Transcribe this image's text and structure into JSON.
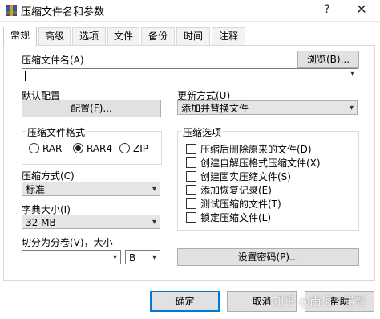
{
  "window": {
    "title": "压缩文件名和参数",
    "help_glyph": "?",
    "close_glyph": "✕"
  },
  "tabs": [
    {
      "label": "常规",
      "active": true
    },
    {
      "label": "高级"
    },
    {
      "label": "选项"
    },
    {
      "label": "文件"
    },
    {
      "label": "备份"
    },
    {
      "label": "时间"
    },
    {
      "label": "注释"
    }
  ],
  "archive_name": {
    "label": "压缩文件名(A)",
    "browse_label": "浏览(B)...",
    "value": ""
  },
  "default_profile": {
    "label": "默认配置",
    "button_label": "配置(F)..."
  },
  "update_mode": {
    "label": "更新方式(U)",
    "value": "添加并替换文件"
  },
  "format": {
    "label": "压缩文件格式",
    "options": [
      "RAR",
      "RAR4",
      "ZIP"
    ],
    "selected": "RAR4"
  },
  "method": {
    "label": "压缩方式(C)",
    "value": "标准"
  },
  "dictionary": {
    "label": "字典大小(I)",
    "value": "32 MB"
  },
  "split": {
    "label": "切分为分卷(V)，大小",
    "value": "",
    "unit": "B"
  },
  "options": {
    "label": "压缩选项",
    "items": [
      {
        "label": "压缩后删除原来的文件(D)",
        "checked": false
      },
      {
        "label": "创建自解压格式压缩文件(X)",
        "checked": false
      },
      {
        "label": "创建固实压缩文件(S)",
        "checked": false
      },
      {
        "label": "添加恢复记录(E)",
        "checked": false
      },
      {
        "label": "测试压缩的文件(T)",
        "checked": false
      },
      {
        "label": "锁定压缩文件(L)",
        "checked": false
      }
    ]
  },
  "password_button": "设置密码(P)...",
  "footer": {
    "ok": "确定",
    "cancel": "取消",
    "help": "帮助"
  },
  "watermark": "知乎 @南柯一诺驾",
  "icons": {
    "dropdown": "chevron-down-icon",
    "app": "winrar-icon"
  }
}
